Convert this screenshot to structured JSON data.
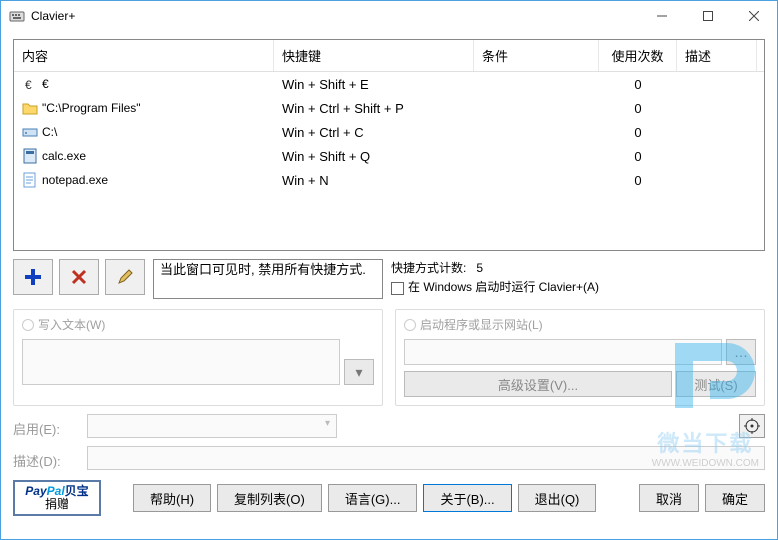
{
  "window": {
    "title": "Clavier+"
  },
  "columns": {
    "c1": "内容",
    "c2": "快捷键",
    "c3": "条件",
    "c4": "使用次数",
    "c5": "描述"
  },
  "rows": [
    {
      "icon": "euro",
      "content": "€",
      "hotkey": "Win + Shift + E",
      "cond": "",
      "count": "0"
    },
    {
      "icon": "folder",
      "content": "\"C:\\Program Files\"",
      "hotkey": "Win + Ctrl + Shift + P",
      "cond": "",
      "count": "0"
    },
    {
      "icon": "drive",
      "content": "C:\\",
      "hotkey": "Win + Ctrl + C",
      "cond": "",
      "count": "0"
    },
    {
      "icon": "calc",
      "content": "calc.exe",
      "hotkey": "Win + Shift + Q",
      "cond": "",
      "count": "0"
    },
    {
      "icon": "notepad",
      "content": "notepad.exe",
      "hotkey": "Win + N",
      "cond": "",
      "count": "0"
    }
  ],
  "note": "当此窗口可见时, 禁用所有快捷方式.",
  "stats": {
    "label": "快捷方式计数:",
    "count": "5",
    "autostart": "在 Windows 启动时运行 Clavier+(A)"
  },
  "groupLeft": {
    "label": "写入文本(W)"
  },
  "groupRight": {
    "label": "启动程序或显示网站(L)",
    "adv": "高级设置(V)...",
    "test": "测试(S)"
  },
  "enable": {
    "label": "启用(E):"
  },
  "desc": {
    "label": "描述(D):"
  },
  "paypal": {
    "brand1": "Pay",
    "brand2": "Pal",
    "brand3": "贝宝",
    "donate": "捐赠"
  },
  "buttons": {
    "help": "帮助(H)",
    "copy": "复制列表(O)",
    "lang": "语言(G)...",
    "about": "关于(B)...",
    "quit": "退出(Q)",
    "cancel": "取消",
    "ok": "确定"
  },
  "watermark": {
    "text": "微当下载",
    "url": "WWW.WEIDOWN.COM"
  }
}
